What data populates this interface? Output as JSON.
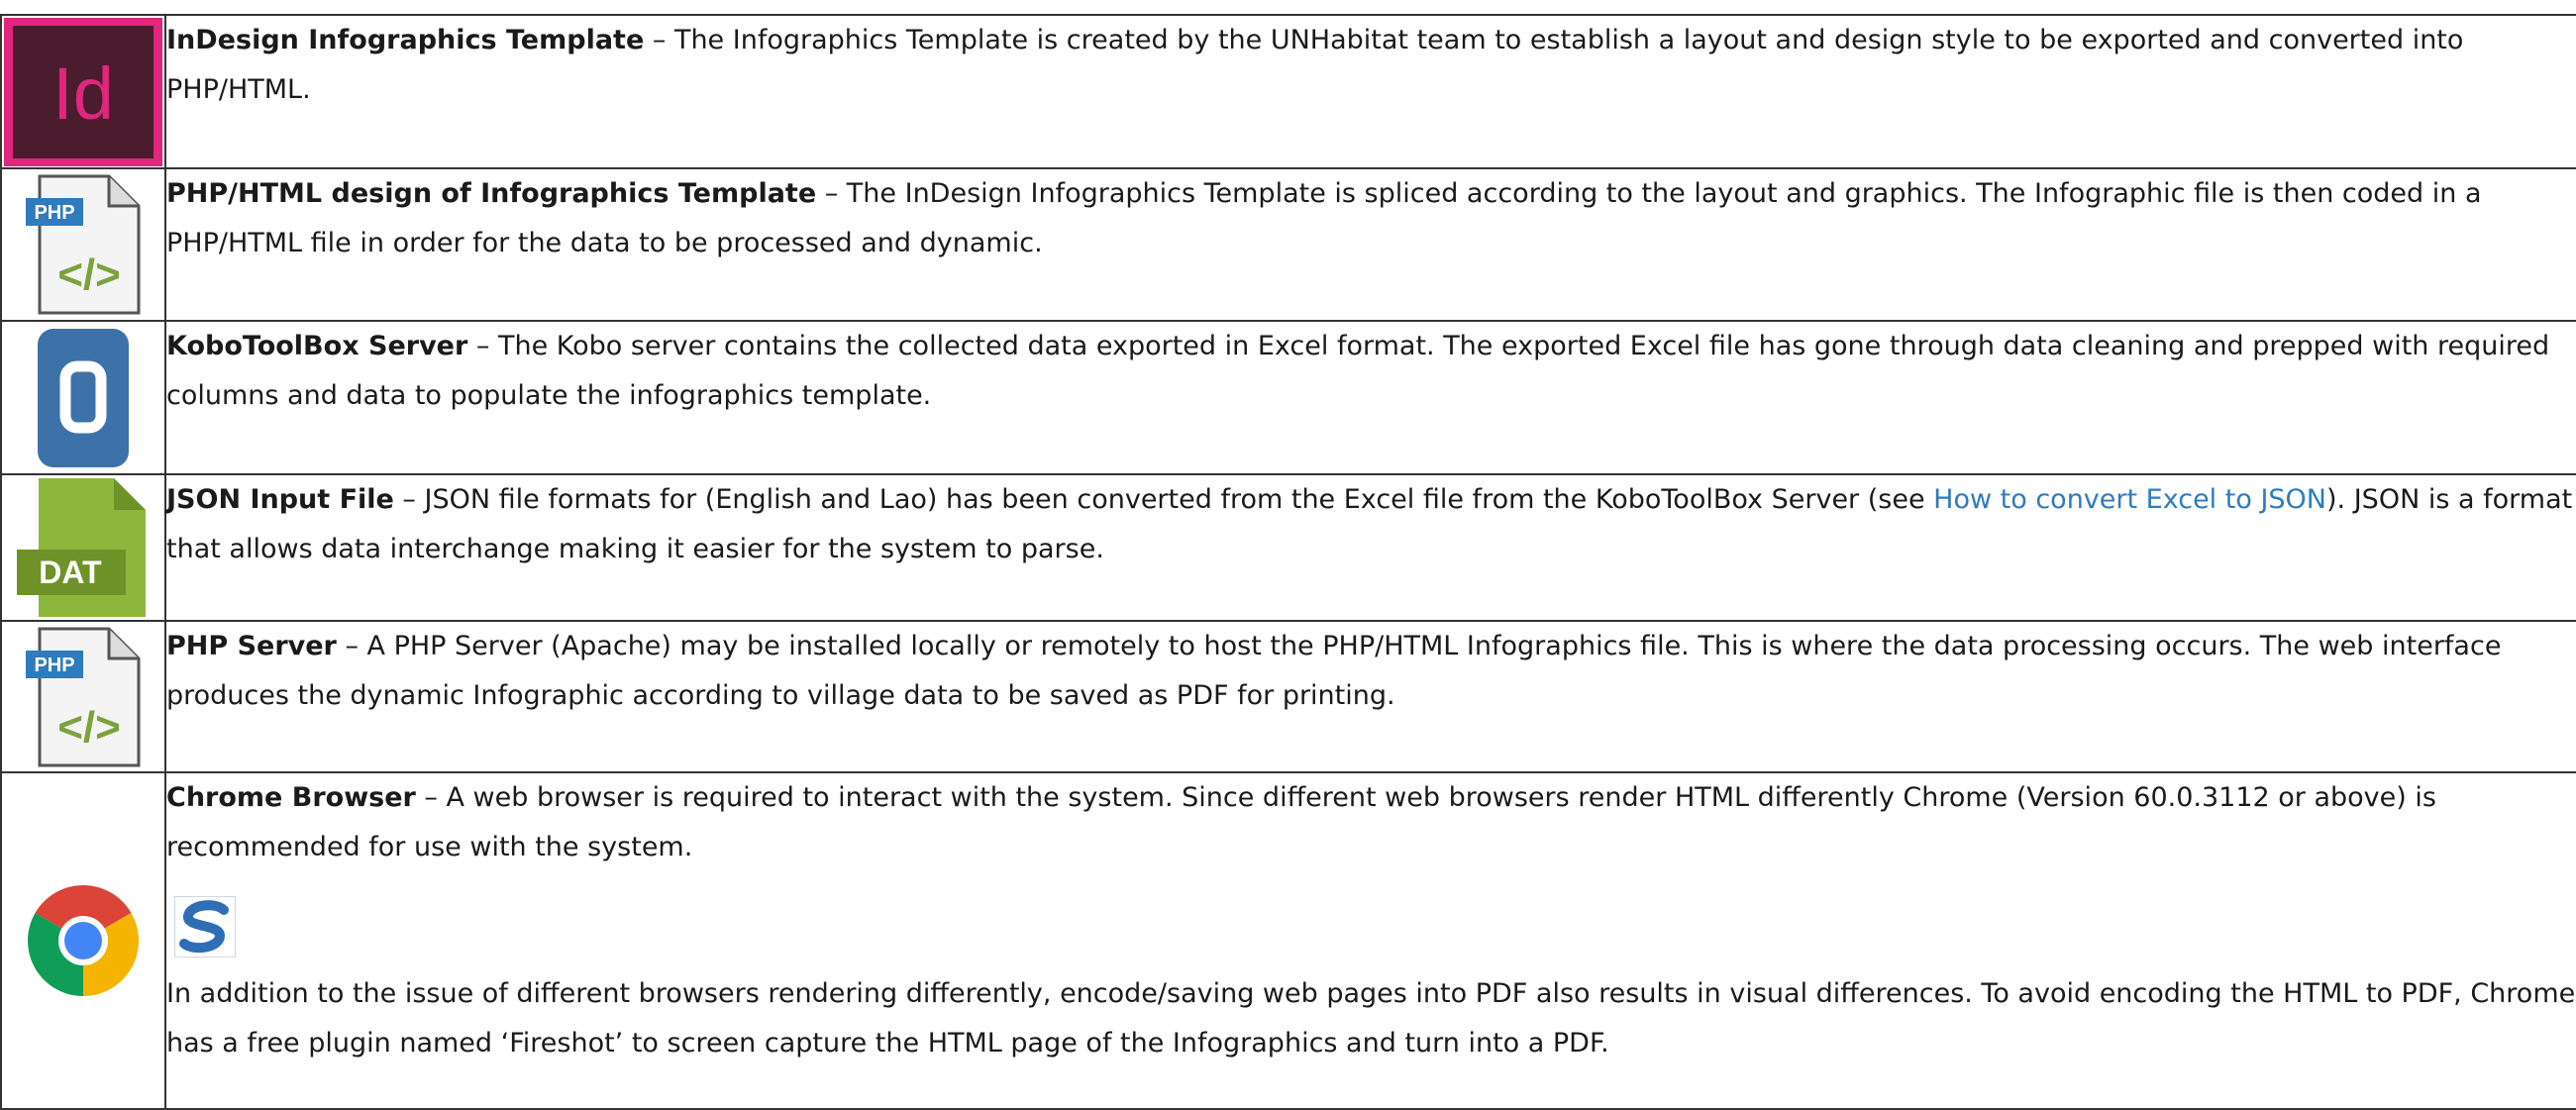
{
  "rows": [
    {
      "icon": "indesign-icon",
      "title": "InDesign Infographics Template",
      "text": " – The Infographics Template is created by the UNHabitat team to establish a layout and design style to be exported and converted into PHP/HTML."
    },
    {
      "icon": "php-file-icon",
      "title": "PHP/HTML design of Infographics Template",
      "text": " – The InDesign Infographics Template is spliced according to the layout and graphics. The Infographic file is then coded in a PHP/HTML file in order for the data to be processed and dynamic."
    },
    {
      "icon": "kobotoolbox-icon",
      "title": "KoboToolBox Server",
      "text": " – The Kobo server contains the collected data exported in Excel format. The exported Excel file has gone through data cleaning and prepped with required columns and data to populate the infographics template."
    },
    {
      "icon": "dat-file-icon",
      "title": "JSON Input File",
      "text_before": " – JSON file formats for (English and Lao) has been converted from the Excel file from the KoboToolBox Server (see ",
      "link": "How to convert Excel to JSON",
      "text_after": "). JSON is a format that allows data interchange making it easier for the system to parse."
    },
    {
      "icon": "php-file-icon",
      "title": "PHP Server",
      "text": " – A PHP Server (Apache) may be installed locally or remotely to host the PHP/HTML Infographics file. This is where the data processing occurs. The web interface produces the dynamic Infographic according to village data to be saved as PDF for printing."
    },
    {
      "icon": "chrome-icon",
      "title": "Chrome Browser",
      "text": " – A web browser is required to interact with the system. Since different web browsers render HTML differently Chrome (Version 60.0.3112 or above) is recommended for use with the system.",
      "extra_icon": "fireshot-icon",
      "extra_text": "In addition to the issue of different browsers rendering differently, encode/saving web pages into PDF also results in visual differences. To avoid encoding the HTML to PDF, Chrome has a free plugin named ‘Fireshot’ to screen capture the HTML page of the Infographics and turn into a PDF."
    }
  ],
  "icons": {
    "php_label": "PHP",
    "php_code": "</>",
    "indesign_label": "Id",
    "dat_label": "DAT"
  },
  "colors": {
    "indesign_bg": "#4a1c2e",
    "indesign_frame": "#e0267d",
    "php_badge": "#2f7bbd",
    "php_code": "#7ba23f",
    "kobo_blue": "#3d72a8",
    "dat_green": "#8db63c",
    "link": "#2f7bbd"
  }
}
